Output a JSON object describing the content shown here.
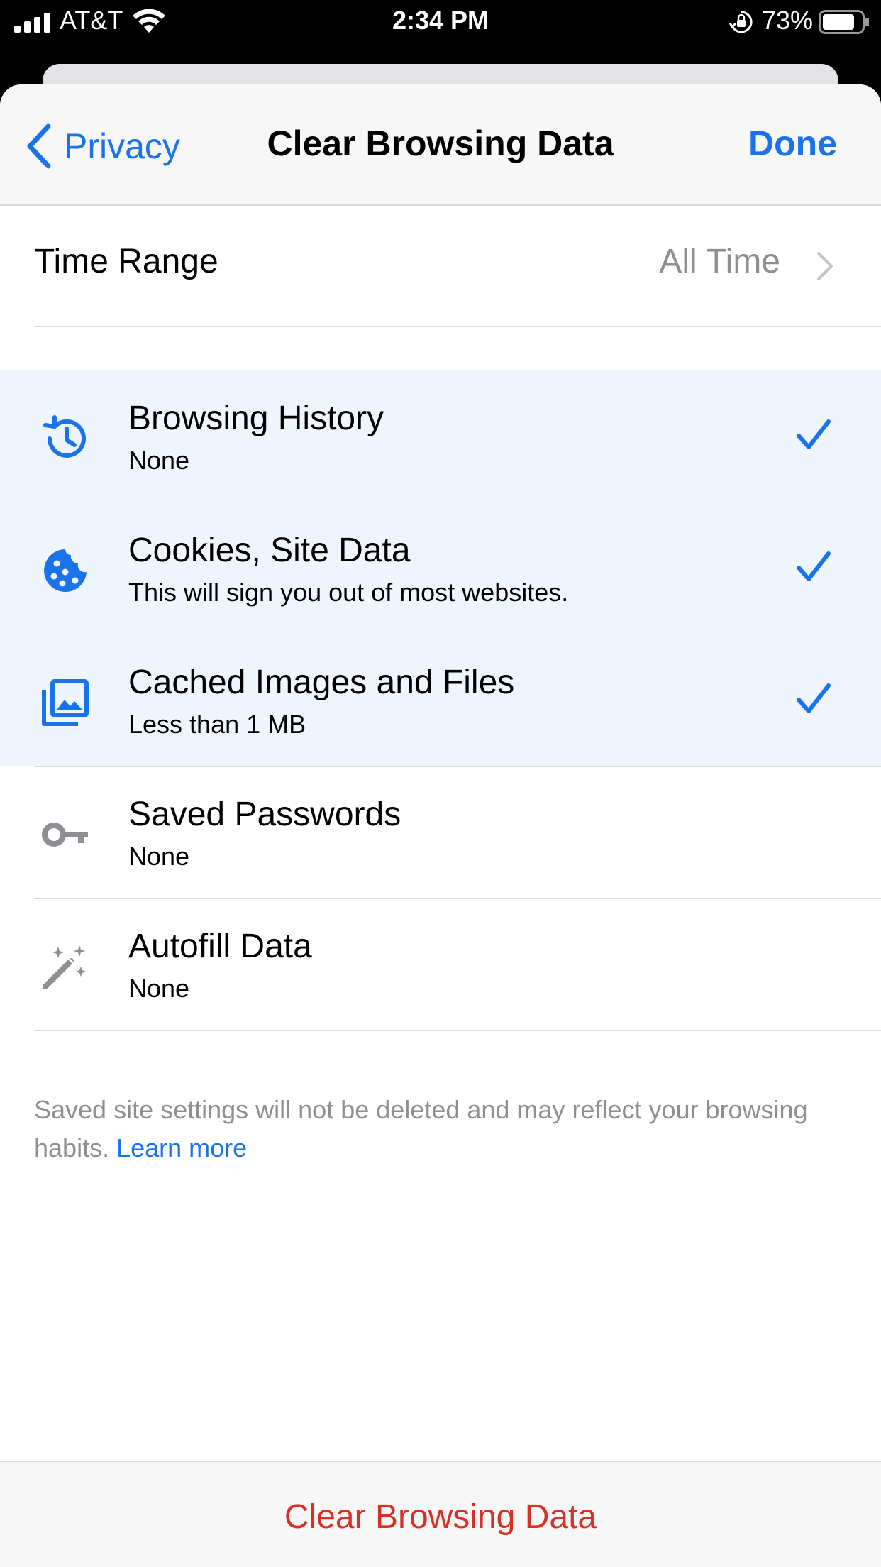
{
  "status_bar": {
    "carrier": "AT&T",
    "time": "2:34 PM",
    "battery": "73%"
  },
  "nav": {
    "back_label": "Privacy",
    "title": "Clear Browsing Data",
    "done_label": "Done"
  },
  "time_range": {
    "label": "Time Range",
    "value": "All Time"
  },
  "items": [
    {
      "title": "Browsing History",
      "subtitle": "None",
      "selected": true,
      "icon": "history-icon"
    },
    {
      "title": "Cookies, Site Data",
      "subtitle": "This will sign you out of most websites.",
      "selected": true,
      "icon": "cookie-icon"
    },
    {
      "title": "Cached Images and Files",
      "subtitle": "Less than 1 MB",
      "selected": true,
      "icon": "images-icon"
    },
    {
      "title": "Saved Passwords",
      "subtitle": "None",
      "selected": false,
      "icon": "key-icon"
    },
    {
      "title": "Autofill Data",
      "subtitle": "None",
      "selected": false,
      "icon": "magic-wand-icon"
    }
  ],
  "footer": {
    "note": "Saved site settings will not be deleted and may reflect your browsing habits. ",
    "link": "Learn more"
  },
  "bottom": {
    "clear_label": "Clear Browsing Data"
  },
  "colors": {
    "accent": "#1a73e8",
    "destructive": "#d93025",
    "selected_bg": "#eef5fd",
    "secondary_text": "#8e8e93"
  }
}
